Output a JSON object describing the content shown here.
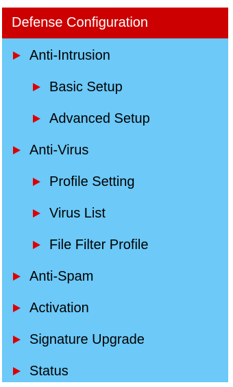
{
  "menu": {
    "header": "Defense Configuration",
    "items": [
      {
        "label": "Anti-Intrusion",
        "level": 0,
        "icon": "red-arrow-icon"
      },
      {
        "label": "Basic Setup",
        "level": 1,
        "icon": "red-arrow-icon"
      },
      {
        "label": "Advanced Setup",
        "level": 1,
        "icon": "red-arrow-icon"
      },
      {
        "label": "Anti-Virus",
        "level": 0,
        "icon": "red-arrow-icon"
      },
      {
        "label": "Profile Setting",
        "level": 1,
        "icon": "red-arrow-icon"
      },
      {
        "label": "Virus List",
        "level": 1,
        "icon": "red-arrow-icon"
      },
      {
        "label": "File Filter Profile",
        "level": 1,
        "icon": "red-arrow-icon"
      },
      {
        "label": "Anti-Spam",
        "level": 0,
        "icon": "red-arrow-icon"
      },
      {
        "label": "Activation",
        "level": 0,
        "icon": "red-arrow-icon"
      },
      {
        "label": "Signature Upgrade",
        "level": 0,
        "icon": "red-arrow-icon"
      },
      {
        "label": "Status",
        "level": 0,
        "icon": "red-arrow-icon"
      }
    ]
  },
  "colors": {
    "header_bg": "#cc0000",
    "menu_bg": "#6cc9f8",
    "arrow": "#dd0000"
  }
}
